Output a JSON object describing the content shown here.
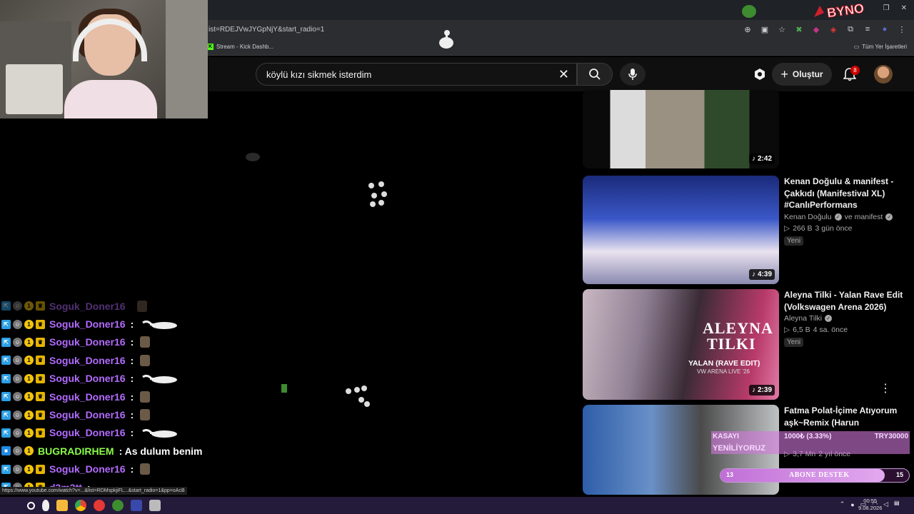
{
  "browser": {
    "url": "ist=RDEJVwJYGpNjY&start_radio=1",
    "bookmark_label": "Stream - Kick Dashb...",
    "bookmarks_right_label": "Tüm Yer İşaretleri",
    "overlay_logo": "BYNO"
  },
  "youtube": {
    "search_value": "köylü kızı sikmek isterdim",
    "create_label": "Oluştur",
    "notification_count": "8"
  },
  "chat": {
    "messages": [
      {
        "user": "Soguk_Doner16",
        "text": "",
        "emote": "small",
        "faded": true
      },
      {
        "user": "Soguk_Doner16",
        "text": ":",
        "emote": "goose"
      },
      {
        "user": "Soguk_Doner16",
        "text": ":",
        "emote": "small"
      },
      {
        "user": "Soguk_Doner16",
        "text": ":",
        "emote": "small"
      },
      {
        "user": "Soguk_Doner16",
        "text": ":",
        "emote": "goose"
      },
      {
        "user": "Soguk_Doner16",
        "text": ":",
        "emote": "small"
      },
      {
        "user": "Soguk_Doner16",
        "text": ":",
        "emote": "small"
      },
      {
        "user": "Soguk_Doner16",
        "text": ":",
        "emote": "goose"
      },
      {
        "user": "BUGRADIRHEM",
        "text": ": As dulum benim",
        "emote": "none",
        "color": "green"
      },
      {
        "user": "Soguk_Doner16",
        "text": ":",
        "emote": "small"
      },
      {
        "user": "d3m3tt",
        "text": ":",
        "emote": "none"
      }
    ]
  },
  "recommendations": [
    {
      "duration": "2:42"
    },
    {
      "title": "Kenan Doğulu & manifest - Çakkıdı (Manifestival XL) #CanlıPerformans",
      "channel": "Kenan Doğulu",
      "channel2": "ve manifest",
      "views": "266 B",
      "age": "3 gün önce",
      "chip": "Yeni",
      "duration": "4:39"
    },
    {
      "title": "Aleyna Tilki - Yalan Rave Edit (Volkswagen Arena 2026)",
      "channel": "Aleyna Tilki",
      "views": "6,5 B",
      "age": "4 sa. önce",
      "chip": "Yeni",
      "duration": "2:39",
      "thumb_title_1": "ALEYNA",
      "thumb_title_2": "TILKI",
      "thumb_sub": "YALAN (RAVE EDIT)",
      "thumb_sub2": "VW ARENA LIVE '26"
    },
    {
      "title": "Fatma Polat-İçime Atıyorum aşk~Remix (Harun",
      "views": "3,7 Mn",
      "age": "2 yıl önce"
    }
  ],
  "overlay": {
    "kasa_line1": "KASAYI",
    "kasa_line2": "YENİLİYORUZ",
    "kasa_progress": "1000₺ (3.33%)",
    "kasa_target": "TRY30000",
    "abone_left": "13",
    "abone_label": "ABONE DESTEK",
    "abone_right": "15",
    "abone_progress": 0.87
  },
  "status_url": "https://www.youtube.com/watch?v=...&list=RDMspkjiFL...&start_radio=1&pp=oAcB",
  "taskbar": {
    "time": "00:55",
    "date": "9.08.2026"
  },
  "colors": {
    "chat_purple": "#b36bff",
    "chat_green": "#8bfc48",
    "yt_bg": "#0f0f0f",
    "overlay_pink": "#d278dc"
  }
}
